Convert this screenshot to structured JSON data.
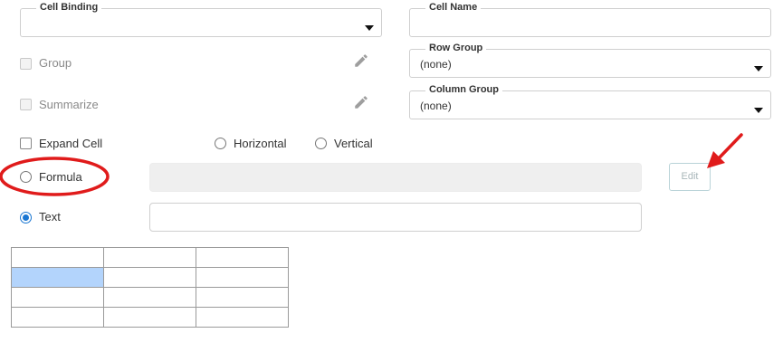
{
  "cell_binding": {
    "legend": "Cell Binding",
    "value": ""
  },
  "cell_name": {
    "legend": "Cell Name",
    "value": ""
  },
  "row_group": {
    "legend": "Row Group",
    "value": "(none)"
  },
  "column_group": {
    "legend": "Column Group",
    "value": "(none)"
  },
  "group": {
    "label": "Group",
    "checked": false,
    "disabled": true
  },
  "summarize": {
    "label": "Summarize",
    "checked": false,
    "disabled": true
  },
  "expand_cell": {
    "label": "Expand Cell",
    "checked": false
  },
  "direction": {
    "horizontal": "Horizontal",
    "vertical": "Vertical",
    "selected": "none"
  },
  "content_type": {
    "formula": "Formula",
    "text": "Text",
    "selected": "text"
  },
  "formula_input": {
    "value": "",
    "disabled": true
  },
  "text_input": {
    "value": ""
  },
  "edit_button": {
    "label": "Edit",
    "disabled": true
  },
  "cell_grid": {
    "rows": 4,
    "cols": 3,
    "selected_row": 2,
    "selected_col": 1
  },
  "annotation": {
    "color": "#e01b1b"
  },
  "icons": {
    "group_edit": "pencil-icon",
    "summarize_edit": "pencil-icon"
  }
}
